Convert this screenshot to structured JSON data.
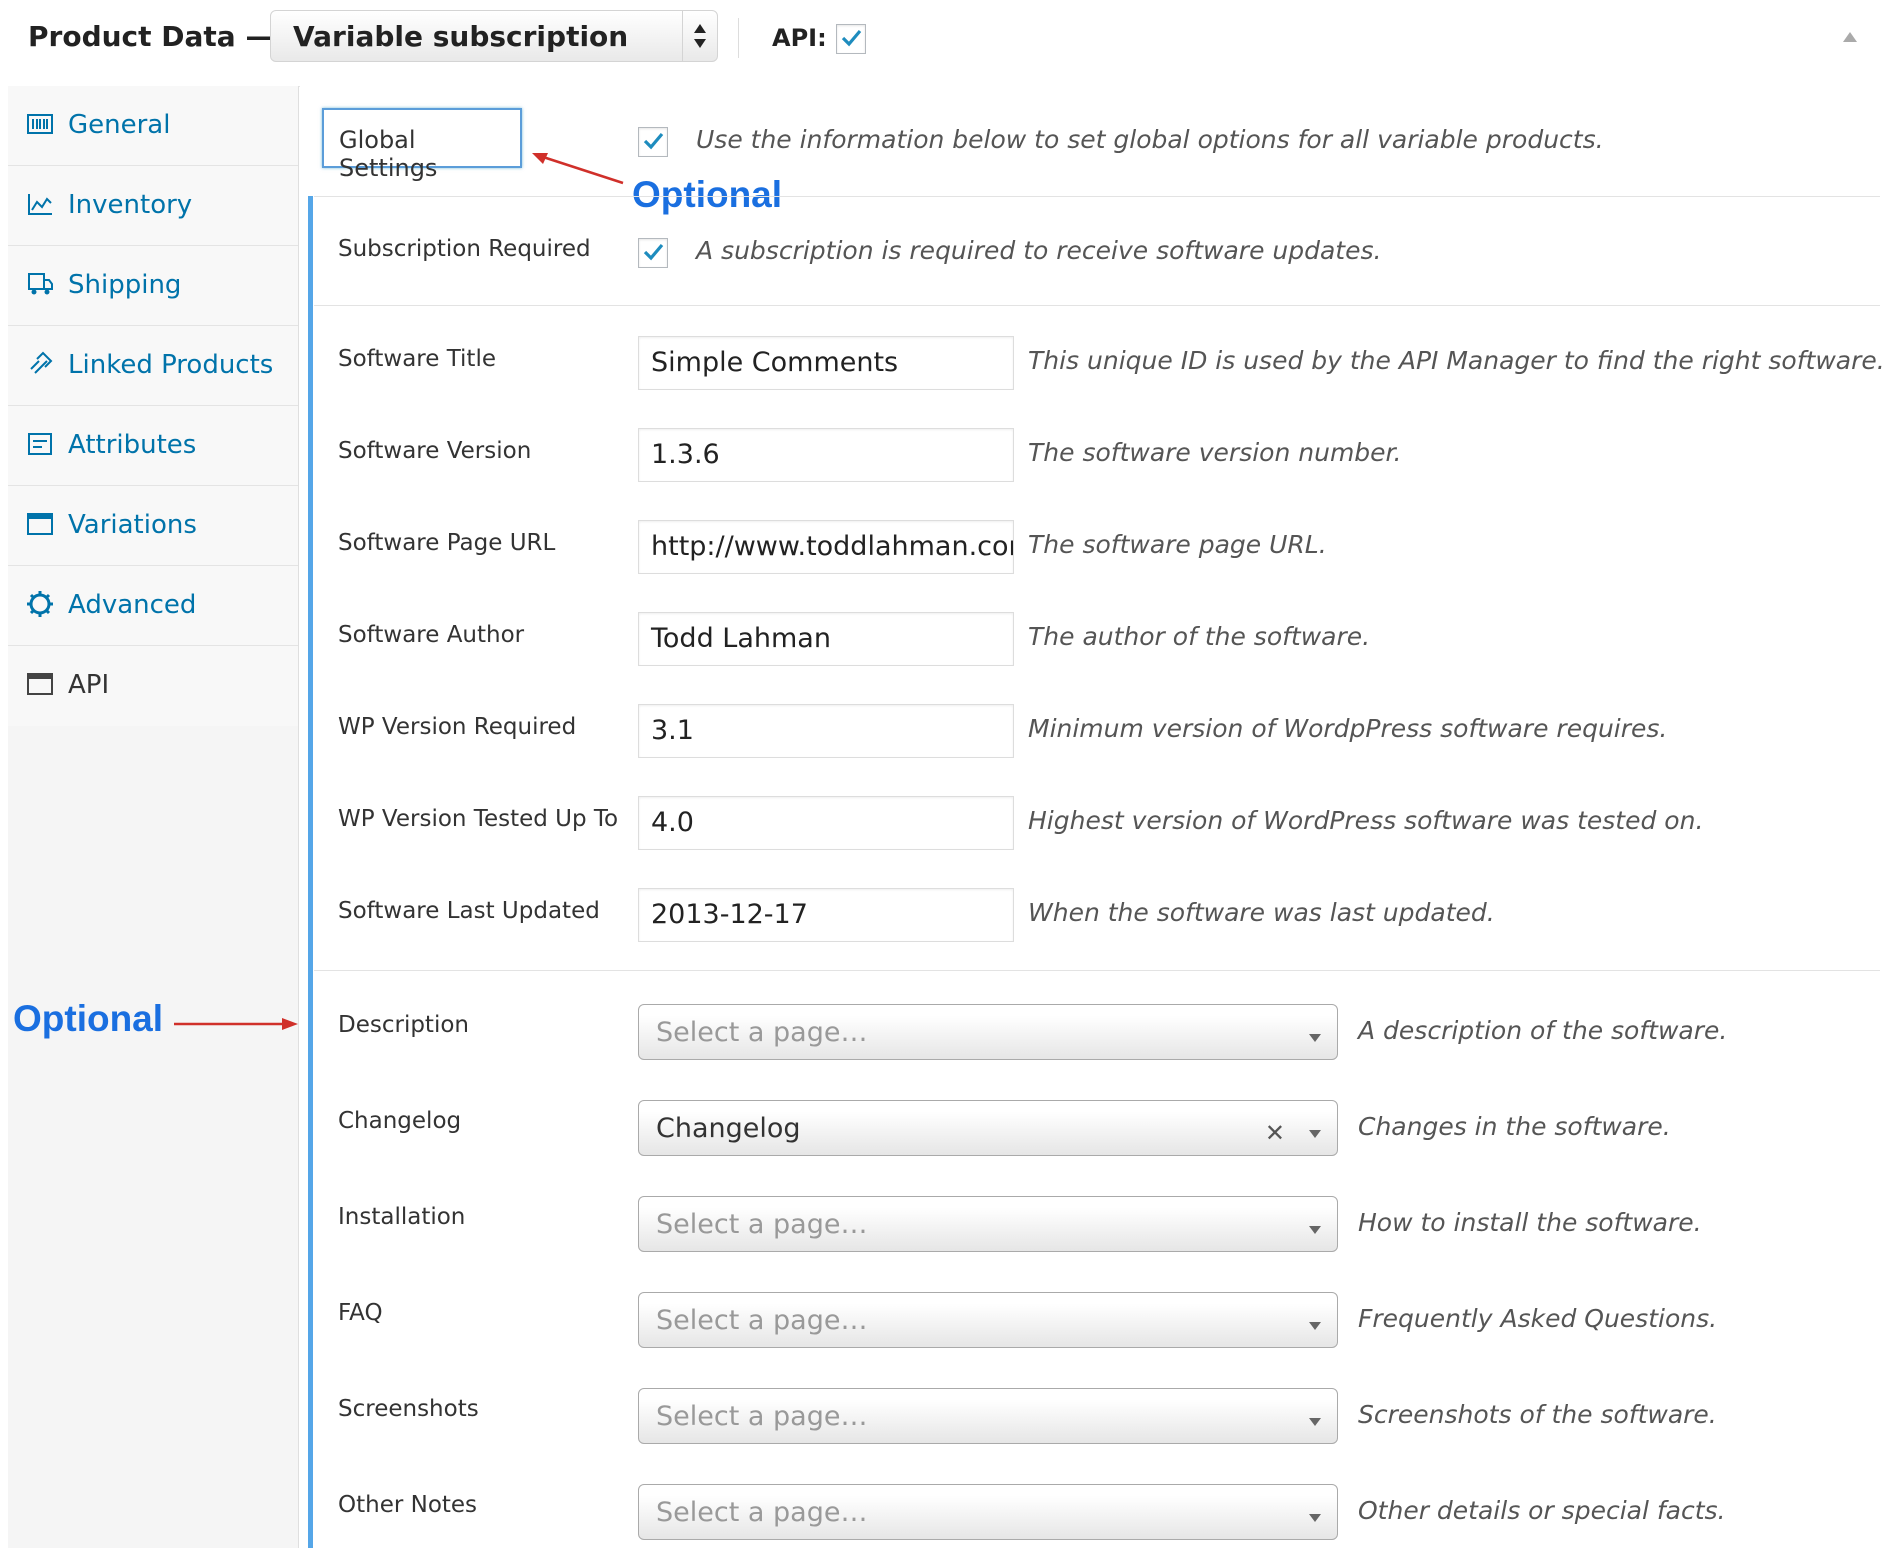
{
  "header": {
    "title": "Product Data —",
    "product_type": "Variable subscription",
    "api_label": "API:",
    "api_checked": true
  },
  "sidebar": {
    "items": [
      {
        "label": "General",
        "icon": "general-icon"
      },
      {
        "label": "Inventory",
        "icon": "inventory-icon"
      },
      {
        "label": "Shipping",
        "icon": "shipping-icon"
      },
      {
        "label": "Linked Products",
        "icon": "link-icon"
      },
      {
        "label": "Attributes",
        "icon": "attributes-icon"
      },
      {
        "label": "Variations",
        "icon": "variations-icon"
      },
      {
        "label": "Advanced",
        "icon": "gear-icon"
      },
      {
        "label": "API",
        "icon": "window-icon"
      }
    ],
    "active": "API"
  },
  "global": {
    "button_label": "Global Settings",
    "checked": true,
    "help": "Use the information below to set global options for all variable products."
  },
  "subscription": {
    "label": "Subscription Required",
    "checked": true,
    "help": "A subscription is required to receive software updates."
  },
  "fields": [
    {
      "label": "Software Title",
      "value": "Simple Comments",
      "help": "This unique ID is used by the API Manager to find the right software."
    },
    {
      "label": "Software Version",
      "value": "1.3.6",
      "help": "The software version number."
    },
    {
      "label": "Software Page URL",
      "value": "http://www.toddlahman.com",
      "help": "The software page URL."
    },
    {
      "label": "Software Author",
      "value": "Todd Lahman",
      "help": "The author of the software."
    },
    {
      "label": "WP Version Required",
      "value": "3.1",
      "help": "Minimum version of WordpPress software requires."
    },
    {
      "label": "WP Version Tested Up To",
      "value": "4.0",
      "help": "Highest version of WordPress software was tested on."
    },
    {
      "label": "Software Last Updated",
      "value": "2013-12-17",
      "help": "When the software was last updated."
    }
  ],
  "pages": [
    {
      "label": "Description",
      "value": "Select a page…",
      "help": "A description of the software."
    },
    {
      "label": "Changelog",
      "value": "Changelog",
      "help": "Changes in the software."
    },
    {
      "label": "Installation",
      "value": "Select a page…",
      "help": "How to install the software."
    },
    {
      "label": "FAQ",
      "value": "Select a page…",
      "help": "Frequently Asked Questions."
    },
    {
      "label": "Screenshots",
      "value": "Select a page…",
      "help": "Screenshots of the software."
    },
    {
      "label": "Other Notes",
      "value": "Select a page…",
      "help": "Other details or special facts."
    }
  ],
  "annotations": {
    "optional_top": "Optional",
    "optional_left": "Optional"
  },
  "colors": {
    "link": "#0073aa",
    "annotation": "#1a6fe0",
    "arrow": "#d0302a",
    "focus": "#5b9dd9",
    "check": "#1e8cbe"
  }
}
